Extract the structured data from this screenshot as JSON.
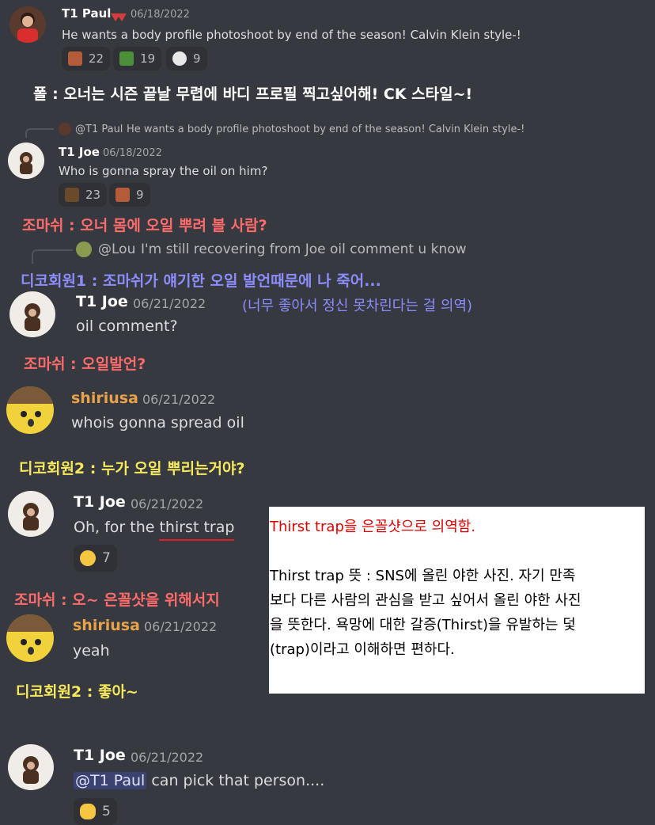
{
  "colors": {
    "bg": "#36393f",
    "name_paul_badge": "#d63d3d",
    "translation_red": "#ff6b6b",
    "translation_blue": "#8c8cff",
    "translation_yellow": "#f7e95c",
    "note_red": "#e00000",
    "shiriusa_name": "#e8a24a"
  },
  "msg1": {
    "author": "T1 Paul",
    "date": "06/18/2022",
    "text": "He wants a body profile photoshoot by end of the season!  Calvin Klein style-!",
    "reactions": [
      {
        "icon": "dog-face-icon",
        "count": "22"
      },
      {
        "icon": "plant-icon",
        "count": "19"
      },
      {
        "icon": "skull-icon",
        "count": "9"
      }
    ]
  },
  "tr1": "폴 : 오너는 시즌 끝날 무렵에 바디 프로필 찍고싶어해! CK 스타일~!",
  "msg2": {
    "reply_author": "@T1 Paul",
    "reply_text": "He wants a body profile photoshoot by end of the season!  Calvin Klein style-!",
    "author": "T1 Joe",
    "date": "06/18/2022",
    "text": "Who is gonna spray the oil on him?",
    "reactions": [
      {
        "icon": "face-icon",
        "count": "23"
      },
      {
        "icon": "dog-face-icon",
        "count": "9"
      }
    ]
  },
  "tr2": "조마쉬 : 오너 몸에 오일 뿌려 볼 사람?",
  "reply3": {
    "author": "@Lou",
    "text": "I'm still recovering from Joe oil comment u know"
  },
  "tr3": "디코회원1 : 조마쉬가 얘기한 오일 발언때문에 나 죽어...",
  "msg3": {
    "author": "T1 Joe",
    "date": "06/21/2022",
    "text": "oil comment?",
    "note": "(너무 좋아서 정신 못차린다는 걸 의역)"
  },
  "tr4": "조마쉬 : 오일발언?",
  "msg4": {
    "author": "shiriusa",
    "date": "06/21/2022",
    "text": "whois gonna spread oil"
  },
  "tr5": "디코회원2 : 누가 오일 뿌리는거야?",
  "msg5": {
    "author": "T1 Joe",
    "date": "06/21/2022",
    "text_prefix": "Oh, for the ",
    "text_highlight": "thirst trap",
    "reactions": [
      {
        "icon": "joy-emoji-icon",
        "count": "7"
      }
    ]
  },
  "tr6": "조마쉬 : 오~ 은꼴샷을 위해서지",
  "msg6": {
    "author": "shiriusa",
    "date": "06/21/2022",
    "text": "yeah"
  },
  "tr7": "디코회원2 : 좋아~",
  "msg7": {
    "author": "T1 Joe",
    "date": "06/21/2022",
    "mention": "@T1 Paul",
    "text": " can pick that person....",
    "reactions": [
      {
        "icon": "ok-hand-icon",
        "count": "5"
      }
    ]
  },
  "note": {
    "title": "Thirst trap을 은꼴샷으로 의역함.",
    "lines": [
      "Thirst trap 뜻 : SNS에 올린 야한 사진. 자기 만족",
      "보다 다른 사람의 관심을 받고 싶어서 올린 야한 사진",
      "을 뜻한다. 욕망에 대한 갈증(Thirst)을 유발하는 덫",
      "(trap)이라고 이해하면 편하다."
    ]
  }
}
